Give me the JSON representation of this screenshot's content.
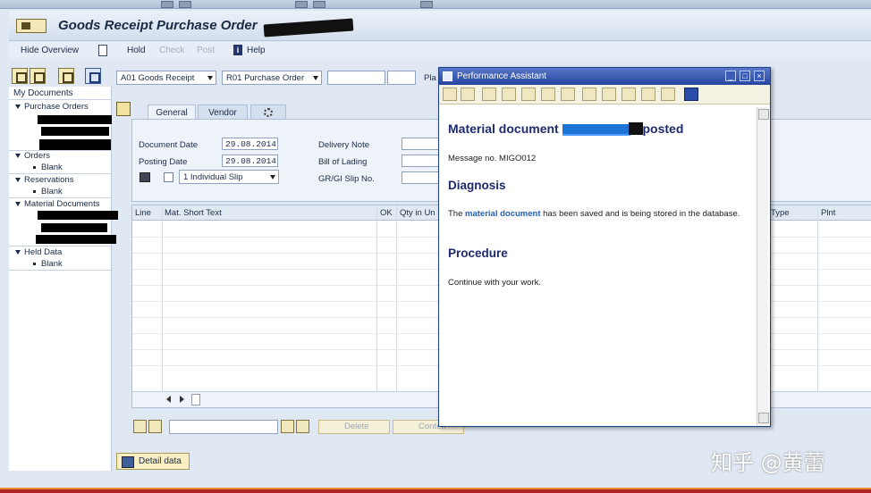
{
  "window": {
    "title": "Goods Receipt Purchase Order"
  },
  "toolbar": {
    "hide_overview": "Hide Overview",
    "hold": "Hold",
    "check": "Check",
    "post": "Post",
    "help": "Help",
    "help_icon_glyph": "i"
  },
  "tree": {
    "header": "My Documents",
    "purchase_orders": "Purchase Orders",
    "orders": "Orders",
    "orders_blank": "Blank",
    "reservations": "Reservations",
    "reservations_blank": "Blank",
    "material_documents": "Material Documents",
    "held_data": "Held Data",
    "held_blank": "Blank"
  },
  "header": {
    "action": "A01 Goods Receipt",
    "reference": "R01 Purchase Order",
    "plant_label": "Pla"
  },
  "tabs": {
    "general": "General",
    "vendor": "Vendor"
  },
  "general": {
    "document_date_label": "Document Date",
    "document_date": "29.08.2014",
    "posting_date_label": "Posting Date",
    "posting_date": "29.08.2014",
    "slip_option": "1 Individual Slip",
    "delivery_note_label": "Delivery Note",
    "bill_of_lading_label": "Bill of Lading",
    "slip_no_label": "GR/GI Slip No."
  },
  "grid": {
    "columns": [
      "Line",
      "Mat. Short Text",
      "OK",
      "Qty in Un",
      "Type",
      "Plnt"
    ]
  },
  "bottom": {
    "delete": "Delete",
    "contents": "Conten",
    "detail_data": "Detail data"
  },
  "popup": {
    "title": "Performance Assistant",
    "heading_prefix": "Material document",
    "heading_suffix": "posted",
    "message": "Message no. MIGO012",
    "diagnosis_title": "Diagnosis",
    "diagnosis_pre": "The",
    "diagnosis_link": "material document",
    "diagnosis_post": "has been saved and is being stored in the database.",
    "procedure_title": "Procedure",
    "procedure_text": "Continue with your work."
  },
  "watermark": "知乎 @黄蕾",
  "colors": {
    "title_bar_blue": "#2745a0",
    "link_blue": "#1f5fb8",
    "heading_navy": "#1e2a6e",
    "status_red": "#b32222"
  }
}
